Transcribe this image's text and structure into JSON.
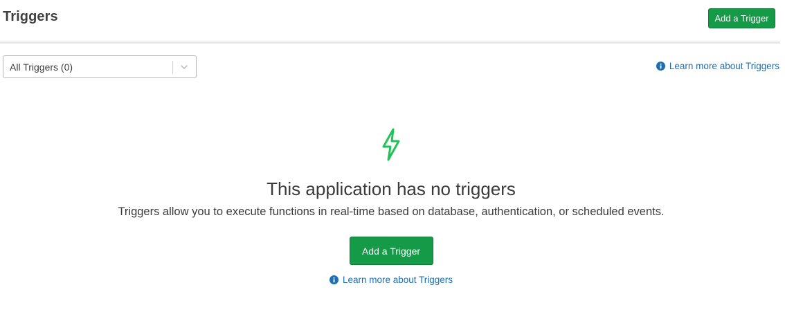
{
  "header": {
    "title": "Triggers",
    "add_button_label": "Add a Trigger"
  },
  "filter": {
    "selected": "All Triggers (0)"
  },
  "learn_more": {
    "label": "Learn more about Triggers"
  },
  "empty_state": {
    "icon": "lightning-bolt-icon",
    "title": "This application has no triggers",
    "description": "Triggers allow you to execute functions in real-time based on database, authentication, or scheduled events.",
    "add_button_label": "Add a Trigger",
    "learn_more_label": "Learn more about Triggers"
  },
  "colors": {
    "primary_green": "#159a47",
    "bolt_green": "#1fc35a",
    "link_blue": "#1a6fb5"
  }
}
